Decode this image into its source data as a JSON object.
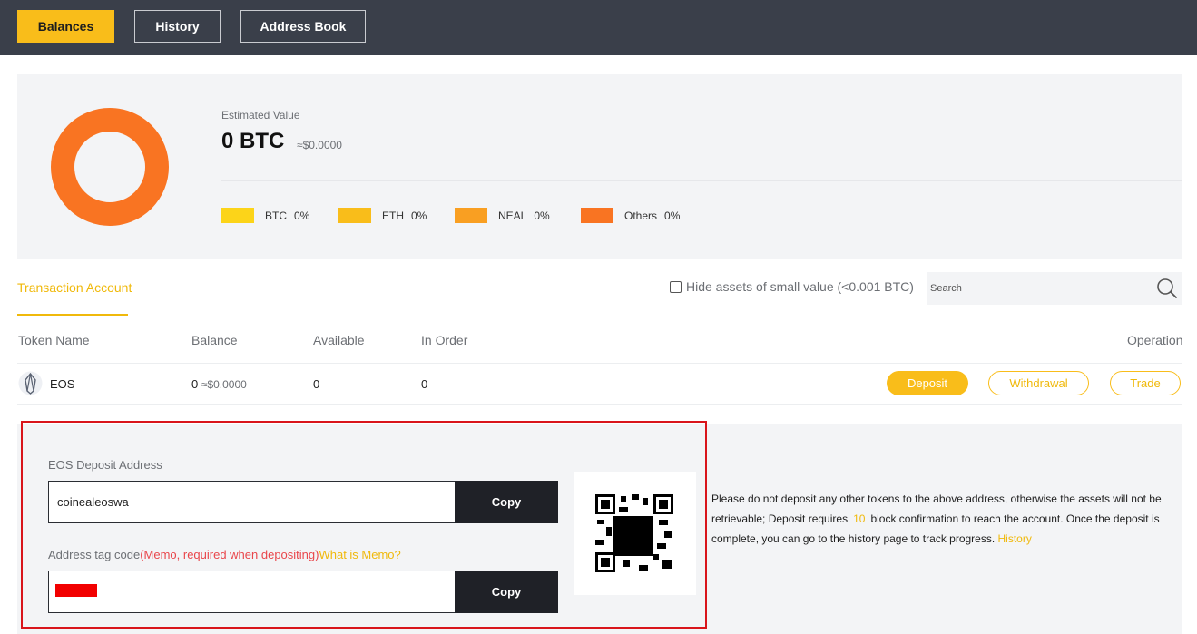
{
  "nav": {
    "tabs": [
      "Balances",
      "History",
      "Address Book"
    ]
  },
  "summary": {
    "estimated_label": "Estimated Value",
    "estimated_value": "0 BTC",
    "estimated_usd": "≈$0.0000",
    "legend": [
      {
        "name": "BTC",
        "pct": "0%",
        "color": "#fcd419"
      },
      {
        "name": "ETH",
        "pct": "0%",
        "color": "#f9bd1a"
      },
      {
        "name": "NEAL",
        "pct": "0%",
        "color": "#f99f22"
      },
      {
        "name": "Others",
        "pct": "0%",
        "color": "#f97422"
      }
    ],
    "donut_color": "#f97422"
  },
  "account": {
    "tab_label": "Transaction Account",
    "hide_small_label": "Hide assets of small value (<0.001 BTC)",
    "hide_small_checked": false,
    "search_placeholder": "Search"
  },
  "table": {
    "headers": [
      "Token Name",
      "Balance",
      "Available",
      "In Order",
      "Operation"
    ],
    "rows": [
      {
        "token": "EOS",
        "balance": "0",
        "balance_usd": "≈$0.0000",
        "available": "0",
        "in_order": "0",
        "actions": [
          "Deposit",
          "Withdrawal",
          "Trade"
        ]
      }
    ]
  },
  "deposit": {
    "address_label": "EOS Deposit Address",
    "address_value": "coinealeoswa",
    "copy_label": "Copy",
    "memo_label": "Address tag code",
    "memo_required": "(Memo, required when depositing)",
    "memo_link": "What is Memo?",
    "notice_part1": "Please do not deposit any other tokens to the above address, otherwise the assets will not be retrievable; Deposit requires",
    "confirmations": "10",
    "notice_part2": "block confirmation to reach the account. Once the deposit is complete, you can go to the history page to track progress.",
    "history_link": "History"
  },
  "colors": {
    "accent": "#f9bd1a",
    "topbar": "#3a3f4a",
    "warning": "#e9464b"
  }
}
